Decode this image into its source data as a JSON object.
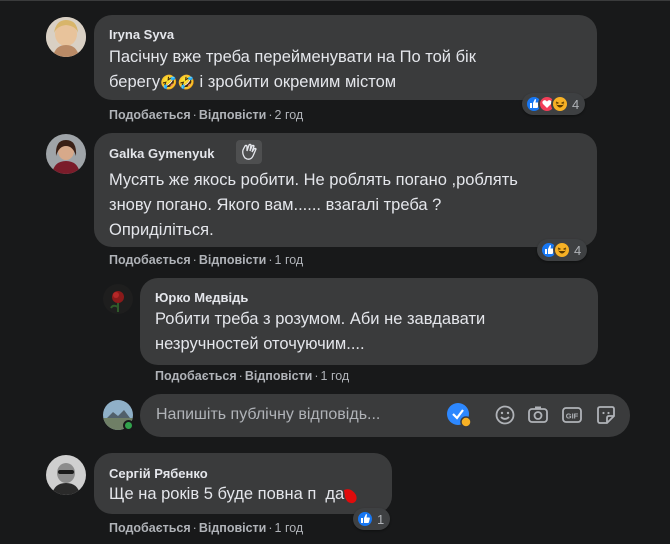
{
  "comments": [
    {
      "author": "Iryna Syva",
      "text_line1": "Пасічну вже треба перейменувати на По той бік",
      "text_line2_start": "берегу",
      "text_line2_emoji": "🤣🤣",
      "text_line2_end": " і зробити окремим містом",
      "like": "Подобається",
      "reply": "Відповісти",
      "time": "2 год",
      "reaction_count": "4"
    },
    {
      "author": "Galka Gymenyuk",
      "text_lines": [
        "Мусять же якось робити. Не роблять погано ,роблять",
        "знову погано. Якого вам...... взагалі треба ?",
        "Опридiлiться."
      ],
      "like": "Подобається",
      "reply": "Відповісти",
      "time": "1 год",
      "reaction_count": "4"
    },
    {
      "author": "Юрко Медвідь",
      "text_lines": [
        "Робити треба з розумом. Аби не завдавати",
        "незручностей оточуючим...."
      ],
      "like": "Подобається",
      "reply": "Відповісти",
      "time": "1 год"
    },
    {
      "author": "Сергій Рябенко",
      "text": "Ще на років 5 буде повна п",
      "text_end": "да",
      "like": "Подобається",
      "reply": "Відповісти",
      "time": "1 год",
      "reaction_count": "1"
    }
  ],
  "reply_box": {
    "placeholder": "Напишіть публічну відповідь..."
  },
  "colors": {
    "like_blue": "#1877f2",
    "love_red": "#f33e58",
    "haha_yellow": "#f7b125",
    "bubble": "#3a3b3c",
    "background": "#18191a"
  },
  "icons": [
    "like-icon",
    "love-icon",
    "haha-icon",
    "emoji-icon",
    "camera-icon",
    "gif-icon",
    "sticker-icon",
    "check-badge-icon",
    "wave-badge-icon"
  ]
}
